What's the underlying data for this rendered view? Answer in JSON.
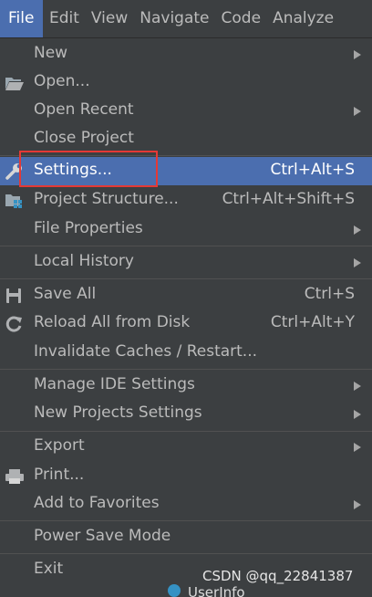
{
  "menubar": {
    "items": [
      "File",
      "Edit",
      "View",
      "Navigate",
      "Code",
      "Analyze"
    ]
  },
  "menu": {
    "new": "New",
    "open": "Open...",
    "open_recent": "Open Recent",
    "close_project": "Close Project",
    "settings": "Settings...",
    "settings_shortcut": "Ctrl+Alt+S",
    "project_structure": "Project Structure...",
    "project_structure_shortcut": "Ctrl+Alt+Shift+S",
    "file_properties": "File Properties",
    "local_history": "Local History",
    "save_all": "Save All",
    "save_all_shortcut": "Ctrl+S",
    "reload": "Reload All from Disk",
    "reload_shortcut": "Ctrl+Alt+Y",
    "invalidate": "Invalidate Caches / Restart...",
    "manage_ide": "Manage IDE Settings",
    "new_projects": "New Projects Settings",
    "export": "Export",
    "print": "Print...",
    "add_favorites": "Add to Favorites",
    "power_save": "Power Save Mode",
    "exit": "Exit"
  },
  "watermark": "CSDN @qq_22841387",
  "background_text": "UserInfo",
  "colors": {
    "menu_bg": "#3c3f41",
    "selection": "#4b6eaf",
    "highlight_box": "#e53935"
  }
}
